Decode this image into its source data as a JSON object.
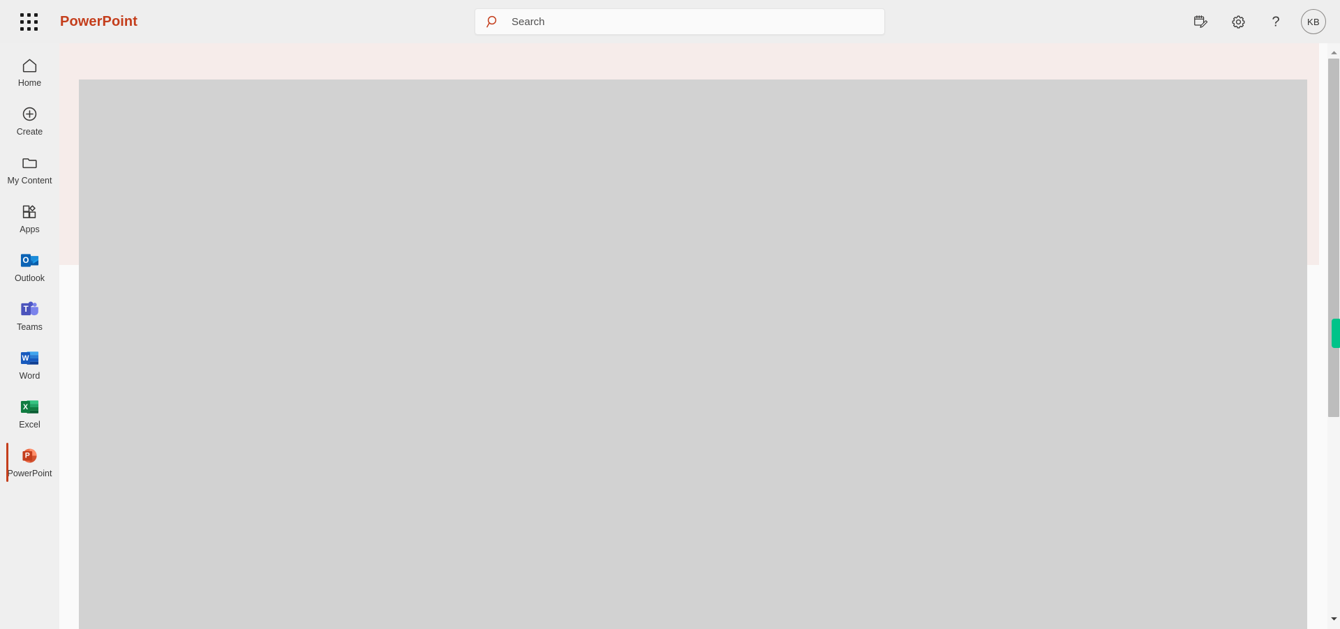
{
  "header": {
    "app_launcher_name": "waffle-grid-icon",
    "app_title": "PowerPoint",
    "brand_color": "#c43e1c",
    "search": {
      "icon": "search-icon",
      "placeholder": "Search",
      "value": ""
    },
    "actions": [
      {
        "name": "feedback-notes-icon",
        "label": "Feedback"
      },
      {
        "name": "gear-icon",
        "label": "Settings"
      },
      {
        "name": "help-icon",
        "label": "Help"
      }
    ],
    "avatar": {
      "initials": "KB",
      "name": "account-avatar"
    }
  },
  "sidebar": {
    "items": [
      {
        "label": "Home",
        "icon": "home-icon",
        "selected": false
      },
      {
        "label": "Create",
        "icon": "plus-circle-icon",
        "selected": false
      },
      {
        "label": "My Content",
        "icon": "folder-icon",
        "selected": false
      },
      {
        "label": "Apps",
        "icon": "apps-grid-icon",
        "selected": false
      },
      {
        "label": "Outlook",
        "icon": "outlook-icon",
        "selected": false
      },
      {
        "label": "Teams",
        "icon": "teams-icon",
        "selected": false
      },
      {
        "label": "Word",
        "icon": "word-icon",
        "selected": false
      },
      {
        "label": "Excel",
        "icon": "excel-icon",
        "selected": false
      },
      {
        "label": "PowerPoint",
        "icon": "powerpoint-icon",
        "selected": true
      }
    ],
    "selected_indicator_color": "#c43e1c"
  },
  "main": {
    "banner_color": "#f6ecea",
    "content_placeholder_color": "#d2d2d2",
    "background_color": "#fafafa"
  },
  "scrollbar": {
    "up_arrow": "scroll-up-arrow-icon",
    "down_arrow": "scroll-down-arrow-icon",
    "thumb": "scrollbar-thumb",
    "marker_color": "#00c389"
  }
}
